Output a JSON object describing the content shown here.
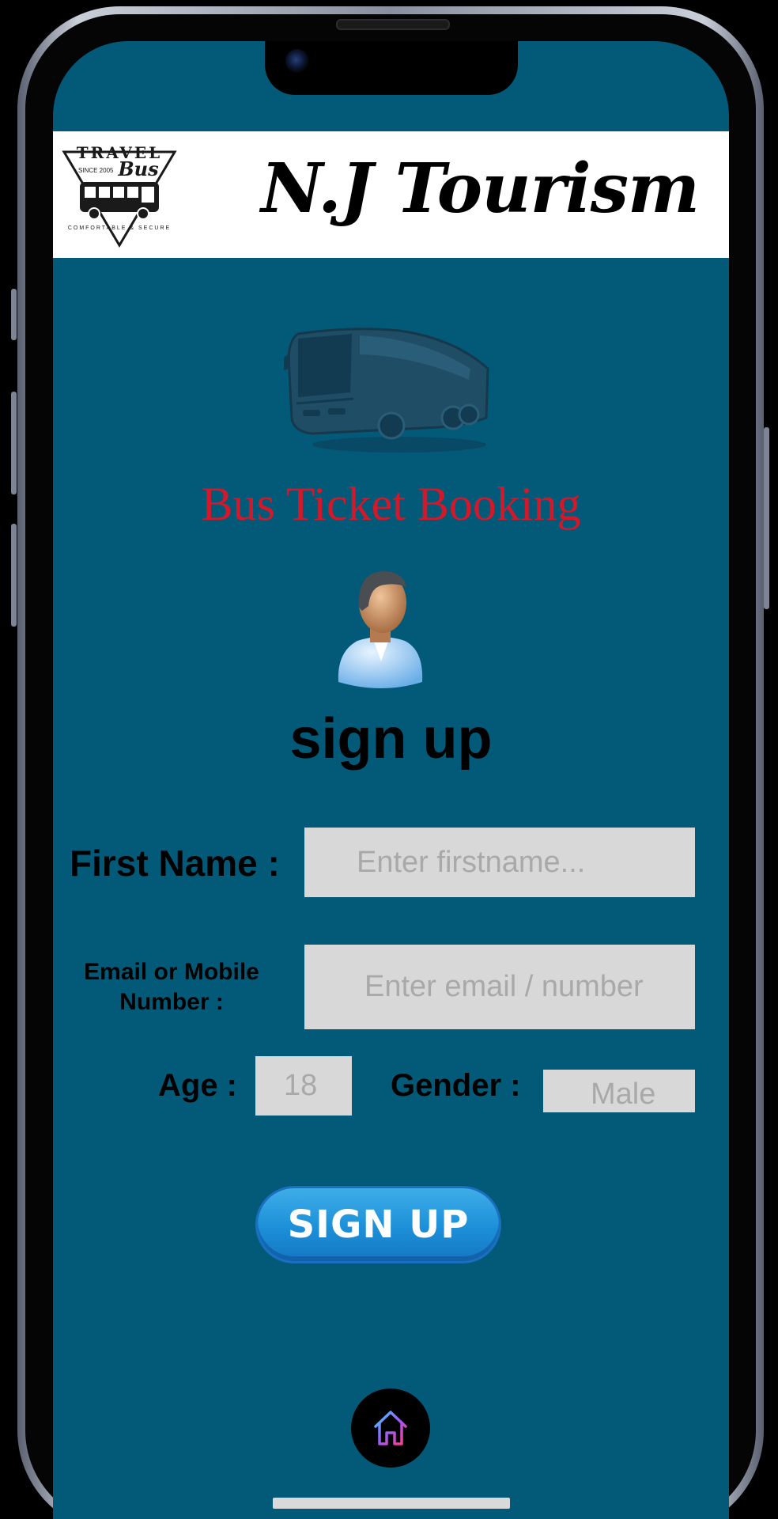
{
  "header": {
    "title": "N.J Tourism",
    "logo": {
      "top_text": "TRAVEL",
      "script_text": "Bus",
      "since_text": "SINCE 2005",
      "bottom_text": "COMFORTABLE & SECURE"
    }
  },
  "hero": {
    "booking_title": "Bus Ticket Booking",
    "bus_icon": "bus-icon",
    "avatar_icon": "user-avatar-icon"
  },
  "form": {
    "heading": "sign up",
    "first_name": {
      "label": "First Name :",
      "placeholder": "Enter firstname...",
      "value": ""
    },
    "email": {
      "label": "Email or Mobile Number :",
      "placeholder": "Enter email / number",
      "value": ""
    },
    "age": {
      "label": "Age :",
      "placeholder": "18",
      "value": ""
    },
    "gender": {
      "label": "Gender :",
      "placeholder": "Male",
      "value": ""
    },
    "submit_label": "SIGN UP"
  },
  "nav": {
    "home_icon": "home-icon"
  },
  "colors": {
    "screen_bg": "#025a78",
    "title_red": "#d4182a",
    "input_bg": "#d8d8d8",
    "button_blue": "#1c8fd8"
  }
}
